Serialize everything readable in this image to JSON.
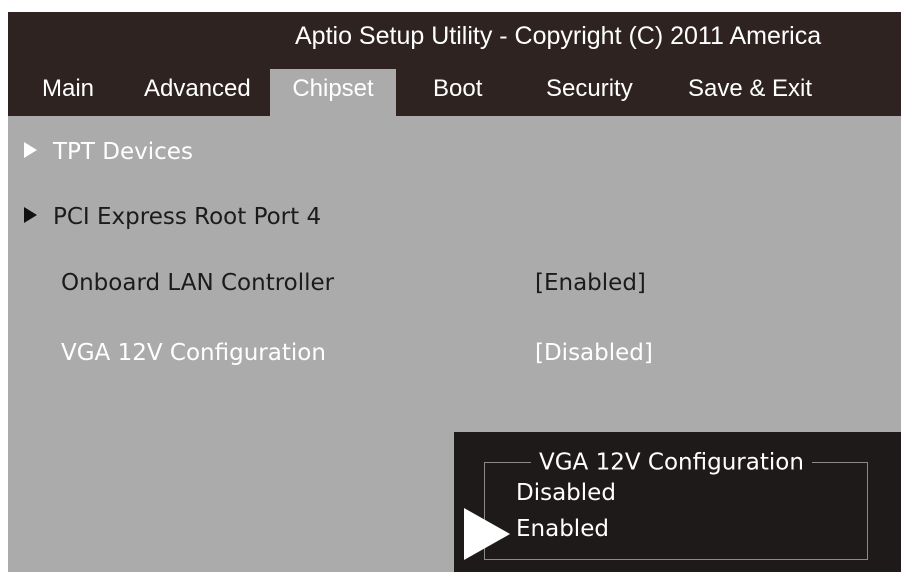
{
  "window": {
    "title": "Aptio Setup Utility - Copyright (C) 2011 America"
  },
  "tabs": [
    {
      "label": "Main"
    },
    {
      "label": "Advanced"
    },
    {
      "label": "Chipset"
    },
    {
      "label": "Boot"
    },
    {
      "label": "Security"
    },
    {
      "label": "Save & Exit"
    }
  ],
  "active_tab": "Chipset",
  "items": [
    {
      "label": "TPT Devices",
      "type": "submenu"
    },
    {
      "label": "PCI Express Root Port 4",
      "type": "submenu"
    },
    {
      "label": "Onboard LAN Controller",
      "value": "[Enabled]"
    },
    {
      "label": "VGA 12V Configuration",
      "value": "[Disabled]"
    }
  ],
  "popup": {
    "title": "VGA 12V Configuration",
    "options": [
      "Disabled",
      "Enabled"
    ],
    "selected": "Enabled"
  },
  "colors": {
    "topbar": "#2e2320",
    "content_bg": "#ababab",
    "popup_bg": "#1e1a19",
    "text_light": "#ffffff",
    "text_dark": "#1b1b1b"
  },
  "icons": {
    "submenu": "triangle-right-icon",
    "selection": "selection-cursor-icon"
  }
}
